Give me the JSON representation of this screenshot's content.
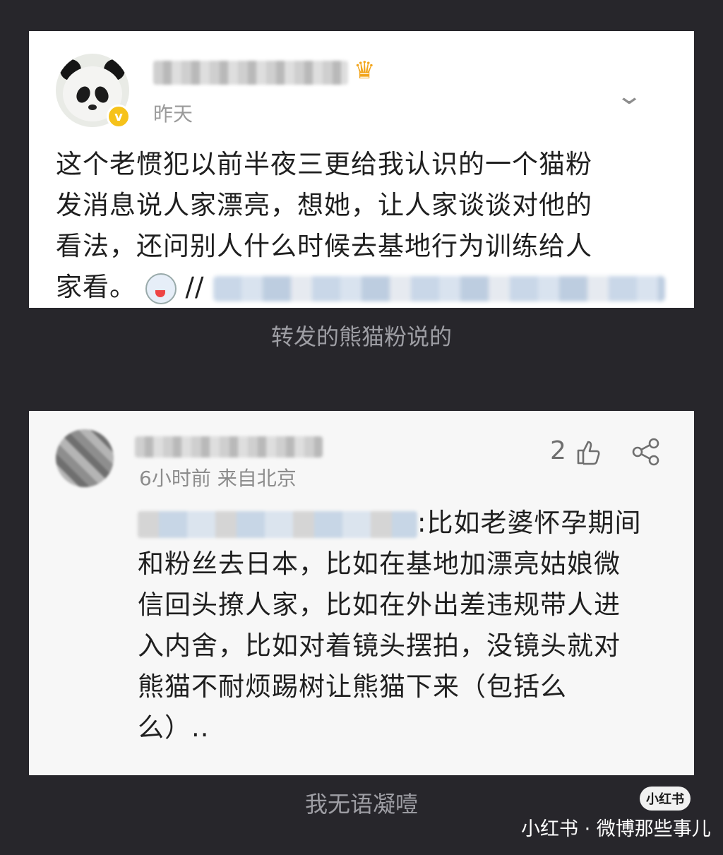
{
  "post": {
    "time": "昨天",
    "body_lines": [
      "这个老惯犯以前半夜三更给我认识的一个猫粉",
      "发消息说人家漂亮，想她，让人家谈谈对他的",
      "看法，还问别人什么时候去基地行为训练给人"
    ],
    "body_last_prefix": "家看。",
    "body_last_slashes": "//"
  },
  "caption_top": "转发的熊猫粉说的",
  "comment": {
    "time": "6小时前  来自北京",
    "likes": "2",
    "mention_suffix": ":比如老婆怀孕期间",
    "body_lines": [
      "和粉丝去日本，比如在基地加漂亮姑娘微",
      "信回头撩人家，比如在外出差违规带人进",
      "入内舍，比如对着镜头摆拍，没镜头就对",
      "熊猫不耐烦踢树让熊猫下来（包括么",
      "么）.."
    ]
  },
  "caption_bottom": "我无语凝噎",
  "watermark": {
    "badge": "小红书",
    "text": "小红书 · 微博那些事儿"
  }
}
